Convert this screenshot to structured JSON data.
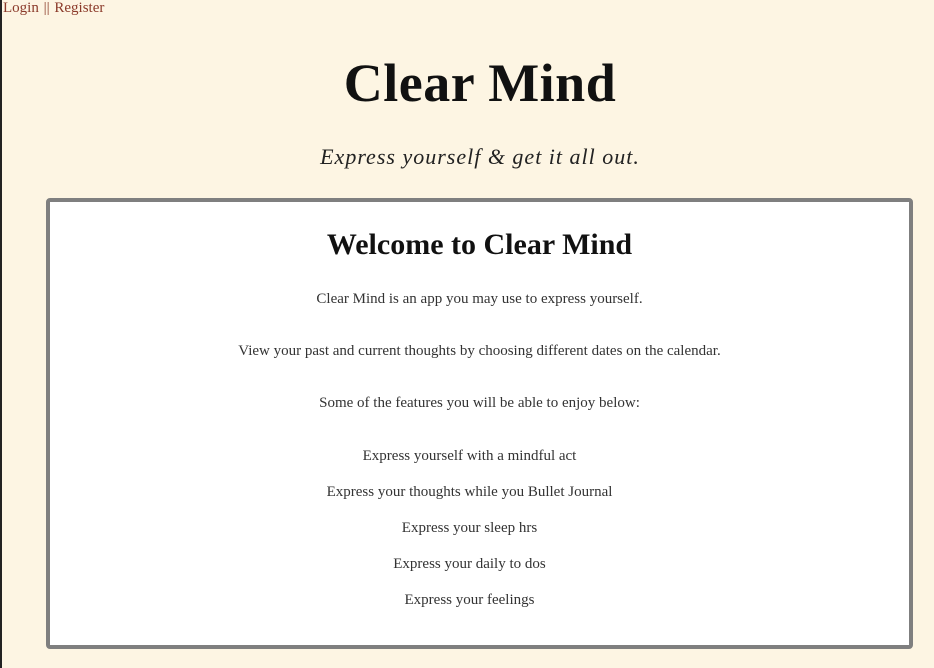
{
  "nav": {
    "login_label": "Login",
    "separator": "||",
    "register_label": "Register"
  },
  "header": {
    "title": "Clear Mind",
    "tagline": "Express yourself & get it all out."
  },
  "welcome": {
    "heading": "Welcome to Clear Mind",
    "intro": "Clear Mind is an app you may use to express yourself.",
    "calendar_note": "View your past and current thoughts by choosing different dates on the calendar.",
    "features_intro": "Some of the features you will be able to enjoy below:",
    "features": [
      "Express yourself with a mindful act",
      "Express your thoughts while you Bullet Journal",
      "Express your sleep hrs",
      "Express your daily to dos",
      "Express your feelings"
    ]
  },
  "colors": {
    "background": "#fdf5e3",
    "link": "#8b3a2a",
    "card_border": "#7f7f7f"
  }
}
